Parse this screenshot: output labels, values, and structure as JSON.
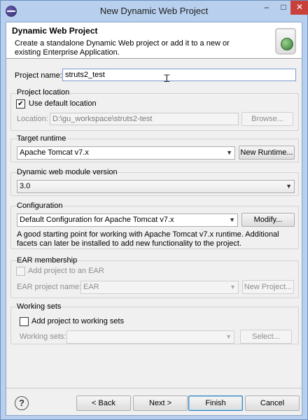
{
  "window": {
    "title": "New Dynamic Web Project"
  },
  "header": {
    "title": "Dynamic Web Project",
    "description": "Create a standalone Dynamic Web project or add it to a new or existing Enterprise Application."
  },
  "project_name": {
    "label": "Project name:",
    "value": "struts2_test"
  },
  "project_location": {
    "group_label": "Project location",
    "use_default_label": "Use default location",
    "use_default_checked": true,
    "location_label": "Location:",
    "location_value": "D:\\gu_workspace\\struts2-test",
    "browse_label": "Browse..."
  },
  "target_runtime": {
    "group_label": "Target runtime",
    "selected": "Apache Tomcat v7.x",
    "new_runtime_label": "New Runtime..."
  },
  "module_version": {
    "group_label": "Dynamic web module version",
    "selected": "3.0"
  },
  "configuration": {
    "group_label": "Configuration",
    "selected": "Default Configuration for Apache Tomcat v7.x",
    "modify_label": "Modify...",
    "description": "A good starting point for working with Apache Tomcat v7.x runtime. Additional facets can later be installed to add new functionality to the project."
  },
  "ear": {
    "group_label": "EAR membership",
    "add_label": "Add project to an EAR",
    "add_checked": false,
    "project_name_label": "EAR project name:",
    "project_name_value": "EAR",
    "new_project_label": "New Project..."
  },
  "working_sets": {
    "group_label": "Working sets",
    "add_label": "Add project to working sets",
    "add_checked": false,
    "sets_label": "Working sets:",
    "sets_value": "",
    "select_label": "Select..."
  },
  "footer": {
    "help_glyph": "?",
    "back_label": "< Back",
    "next_label": "Next >",
    "finish_label": "Finish",
    "cancel_label": "Cancel"
  },
  "icons": {
    "app": "eclipse-icon",
    "help": "help-icon",
    "banner": "web-project-jar-icon",
    "cursor": "text-cursor-icon"
  }
}
